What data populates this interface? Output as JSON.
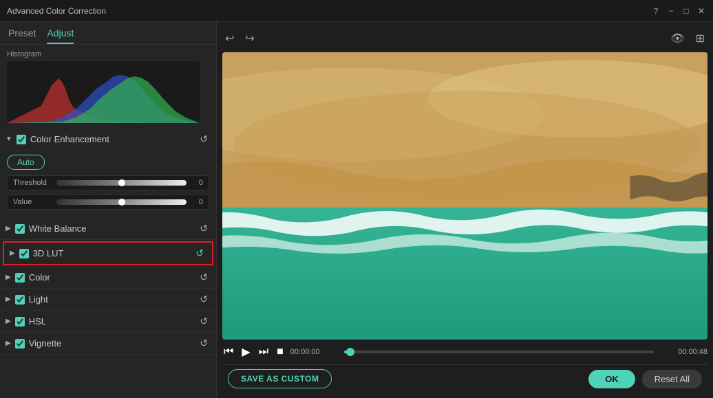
{
  "titlebar": {
    "title": "Advanced Color Correction",
    "help_icon": "?",
    "minimize_icon": "−",
    "maximize_icon": "□",
    "close_icon": "✕"
  },
  "tabs": [
    {
      "label": "Preset",
      "active": false
    },
    {
      "label": "Adjust",
      "active": true
    }
  ],
  "histogram": {
    "label": "Histogram"
  },
  "toolbar": {
    "undo_icon": "undo",
    "redo_icon": "redo",
    "preview_icon": "eye",
    "compare_icon": "compare"
  },
  "color_enhancement": {
    "label": "Color Enhancement",
    "auto_label": "Auto",
    "threshold_label": "Threshold",
    "threshold_value": "0",
    "value_label": "Value",
    "value_value": "0",
    "reset_icon": "↺"
  },
  "sections": [
    {
      "name": "White Balance",
      "checked": true,
      "reset_icon": "↺"
    },
    {
      "name": "3D LUT",
      "checked": true,
      "reset_icon": "↺",
      "highlighted": true
    },
    {
      "name": "Color",
      "checked": true,
      "reset_icon": "↺"
    },
    {
      "name": "Light",
      "checked": true,
      "reset_icon": "↺"
    },
    {
      "name": "HSL",
      "checked": true,
      "reset_icon": "↺"
    },
    {
      "name": "Vignette",
      "checked": true,
      "reset_icon": "↺"
    }
  ],
  "playback": {
    "prev_icon": "⏮",
    "play_icon": "▶",
    "next_icon": "▶▶",
    "stop_icon": "■",
    "current_time": "00:00:00",
    "total_time": "00:00:48"
  },
  "bottom": {
    "save_custom_label": "SAVE AS CUSTOM",
    "ok_label": "OK",
    "reset_all_label": "Reset All"
  }
}
